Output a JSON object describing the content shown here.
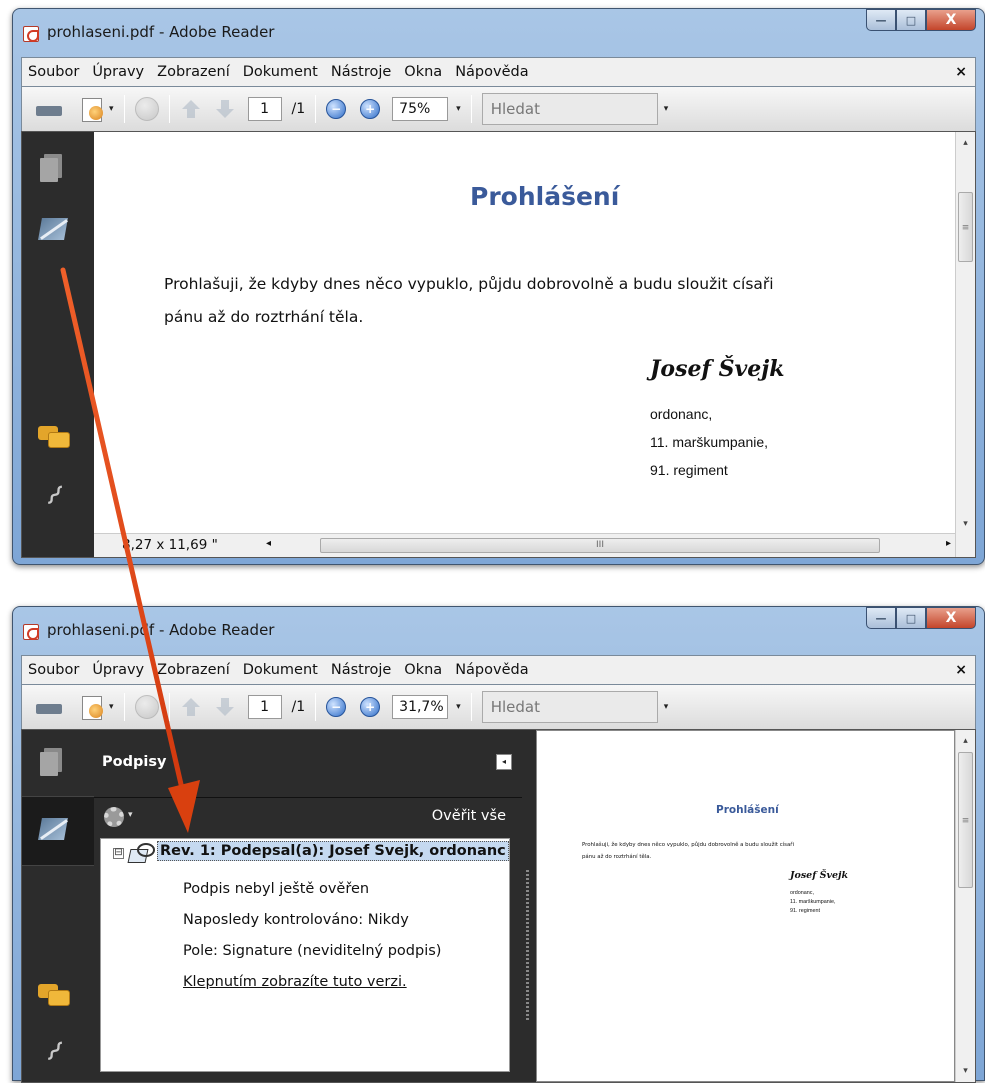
{
  "window1": {
    "title": "prohlaseni.pdf - Adobe Reader",
    "controls": {
      "minimize": "—",
      "maximize": "□",
      "close": "X"
    },
    "menu": [
      "Soubor",
      "Úpravy",
      "Zobrazení",
      "Dokument",
      "Nástroje",
      "Okna",
      "Nápověda"
    ],
    "menu_close": "×",
    "toolbar": {
      "page_current": "1",
      "page_total": "/1",
      "zoom_out": "−",
      "zoom_in": "+",
      "zoom": "75%",
      "dropdown_arrow": "▾",
      "search_placeholder": "Hledat"
    },
    "nav_icons": [
      "pages-icon",
      "signatures-icon",
      "comments-icon",
      "attachments-icon"
    ],
    "document": {
      "title": "Prohlášení",
      "body_line1": "Prohlašuji, že kdyby dnes něco vypuklo, půjdu dobrovolně a budu sloužit císaři",
      "body_line2": "pánu až do roztrhání těla.",
      "signature": "Josef Švejk",
      "sig_line1": "ordonanc,",
      "sig_line2": "11. marškumpanie,",
      "sig_line3": "91. regiment"
    },
    "status": {
      "page_size": "8,27 x 11,69 \"",
      "scroll_left": "◂",
      "scroll_right": "▸",
      "scroll_grip": "III"
    },
    "scroll": {
      "up": "▴",
      "down": "▾",
      "grip": "≡"
    }
  },
  "window2": {
    "title": "prohlaseni.pdf - Adobe Reader",
    "controls": {
      "minimize": "—",
      "maximize": "□",
      "close": "X"
    },
    "menu": [
      "Soubor",
      "Úpravy",
      "Zobrazení",
      "Dokument",
      "Nástroje",
      "Okna",
      "Nápověda"
    ],
    "menu_close": "×",
    "toolbar": {
      "page_current": "1",
      "page_total": "/1",
      "zoom_out": "−",
      "zoom_in": "+",
      "zoom": "31,7%",
      "dropdown_arrow": "▾",
      "search_placeholder": "Hledat"
    },
    "signatures_panel": {
      "title": "Podpisy",
      "collapse": "◂",
      "verify_all": "Ověřit vše",
      "options_arrow": "▾",
      "expand": "⊟",
      "rev_label": "Rev. 1: Podepsal(a): Josef Svejk, ordonanc",
      "items": [
        "Podpis nebyl ještě ověřen",
        "Naposledy kontrolováno: Nikdy",
        "Pole: Signature (neviditelný podpis)"
      ],
      "link": "Klepnutím zobrazíte tuto verzi."
    },
    "document": {
      "title": "Prohlášení",
      "body_line1": "Prohlašuji, že kdyby dnes něco vypuklo, půjdu dobrovolně a budu sloužit císaři",
      "body_line2": "pánu až do roztrhání těla.",
      "signature": "Josef Švejk",
      "sig_line1": "ordonanc,",
      "sig_line2": "11. marškumpanie,",
      "sig_line3": "91. regiment"
    },
    "scroll": {
      "up": "▴",
      "down": "▾",
      "grip": "≡"
    }
  },
  "colors": {
    "accent_arrow": "#e0461c",
    "doc_title": "#3a5a9a",
    "nav_dark": "#2c2c2c",
    "selection": "#c5d9f0"
  }
}
